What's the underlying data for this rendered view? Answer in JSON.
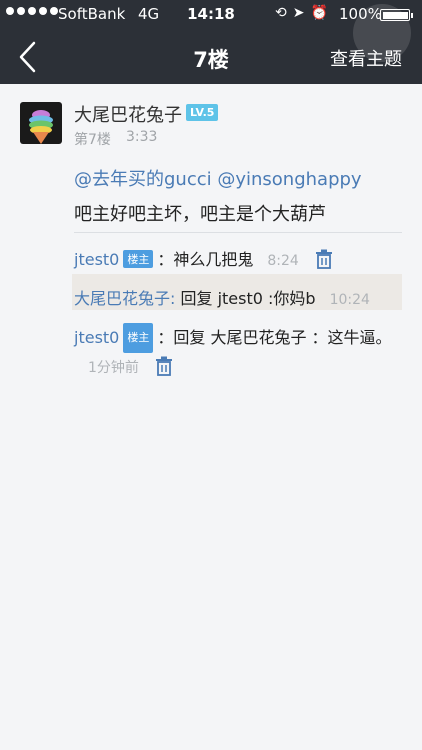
{
  "status_bar": {
    "carrier": "SoftBank",
    "network": "4G",
    "time": "14:18",
    "icons": [
      "lock-rotation-icon",
      "location-arrow-icon",
      "alarm-icon"
    ],
    "battery": "100%"
  },
  "nav": {
    "title": "7楼",
    "action": "查看主题"
  },
  "post": {
    "author": "大尾巴花兔子",
    "level": "LV.5",
    "floor": "第7楼",
    "time": "3:33",
    "mention": "@去年买的gucci @yinsonghappy",
    "content": "吧主好吧主坏，吧主是个大葫芦"
  },
  "replies": [
    {
      "user": "jtest0",
      "tag": "楼主",
      "text": "：神么几把鬼",
      "time": "8:24"
    },
    {
      "user": "大尾巴花兔子:",
      "text": "回复 jtest0 :你妈b",
      "time": "10:24"
    },
    {
      "user": "jtest0",
      "tag": "楼主",
      "text": "：回复 大尾巴花兔子 ：这牛逼。",
      "time": "1分钟前"
    }
  ],
  "colors": {
    "nav_bg": "#2c3037",
    "link": "#4a7bb5",
    "lv_badge": "#5ec3e8",
    "owner_tag": "#4d9de0"
  }
}
